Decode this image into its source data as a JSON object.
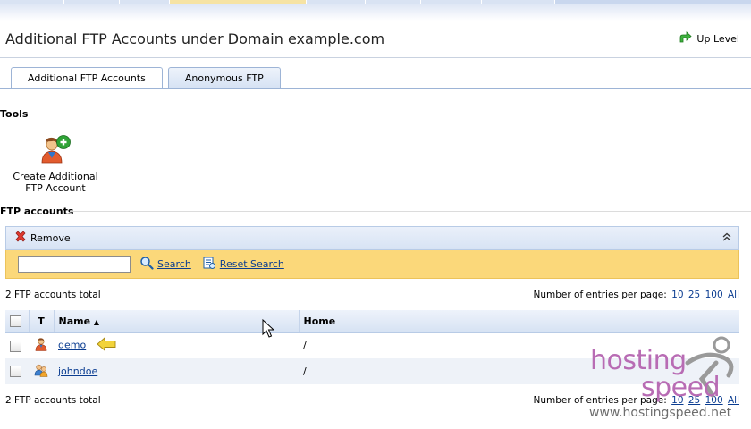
{
  "header": {
    "title": "Additional FTP Accounts under Domain example.com",
    "up_level": "Up Level"
  },
  "tabs": [
    {
      "label": "Additional FTP Accounts",
      "active": true
    },
    {
      "label": "Anonymous FTP",
      "active": false
    }
  ],
  "tools": {
    "heading": "Tools",
    "create_label": "Create Additional FTP Account",
    "create_icon": "user-add-icon"
  },
  "ftp": {
    "heading": "FTP accounts",
    "remove_label": "Remove",
    "search_value": "",
    "search_label": "Search",
    "reset_label": "Reset Search",
    "total": "2 FTP accounts total",
    "perpage_label": "Number of entries per page:",
    "perpage_options": [
      "10",
      "25",
      "100",
      "All"
    ],
    "columns": {
      "type": "T",
      "name": "Name",
      "sort_indicator": "▲",
      "home": "Home"
    },
    "rows": [
      {
        "name": "demo",
        "home": "/",
        "icon": "user-icon",
        "pointer": true
      },
      {
        "name": "johndoe",
        "home": "/",
        "icon": "user-shared-icon",
        "pointer": false
      }
    ]
  },
  "watermark": {
    "line1": "hosting",
    "line2": "speed",
    "url": "www.hostingspeed.net"
  },
  "colors": {
    "accent_blue": "#0b3d91",
    "search_bar": "#fbd87a",
    "watermark": "#b86cb4"
  }
}
